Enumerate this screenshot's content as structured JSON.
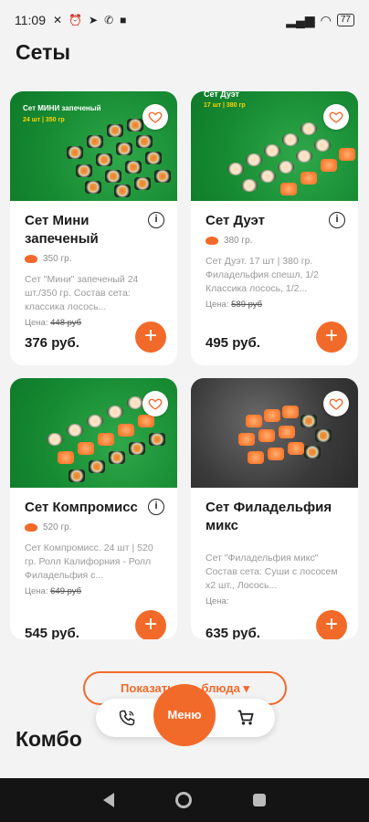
{
  "status_bar": {
    "time": "11:09",
    "battery": "77"
  },
  "sections": {
    "sets_title": "Сеты",
    "combo_title": "Комбо"
  },
  "products": [
    {
      "title": "Сет Мини запеченый",
      "weight": "350 гр.",
      "description": "Сет \"Мини\" запеченый 24 шт./350 гр. Состав сета: классика лосось...",
      "old_price_label": "Цена:",
      "old_price": "448 руб",
      "price": "376 руб.",
      "banner_title": "Сет МИНИ запеченый",
      "banner_sub": "24 шт | 350 гр"
    },
    {
      "title": "Сет Дуэт",
      "weight": "380 гр.",
      "description": "Сет Дуэт. 17 шт | 380 гр. Филадельфия спешл, 1/2 Классика лосось, 1/2...",
      "old_price_label": "Цена:",
      "old_price": "589 руб",
      "price": "495 руб.",
      "banner_title": "Сет Дуэт",
      "banner_sub": "17 шт | 380 гр"
    },
    {
      "title": "Сет Компромисс",
      "weight": "520 гр.",
      "description": "Сет Компромисс. 24 шт | 520 гр. Ролл Калифорния - Ролл Филадельфия с...",
      "old_price_label": "Цена:",
      "old_price": "649 руб",
      "price": "545 руб."
    },
    {
      "title": "Сет Филадельфия микс",
      "weight": "",
      "description": "Сет \"Филадельфия микс\" Состав сета: Суши с лососем х2 шт., Лосось...",
      "old_price_label": "Цена:",
      "old_price": "",
      "price": "635 руб."
    }
  ],
  "show_all_button": "Показать все блюда",
  "bottom_nav": {
    "menu_label": "Меню"
  },
  "colors": {
    "accent": "#f26a2a",
    "background": "#f3f3f3"
  }
}
